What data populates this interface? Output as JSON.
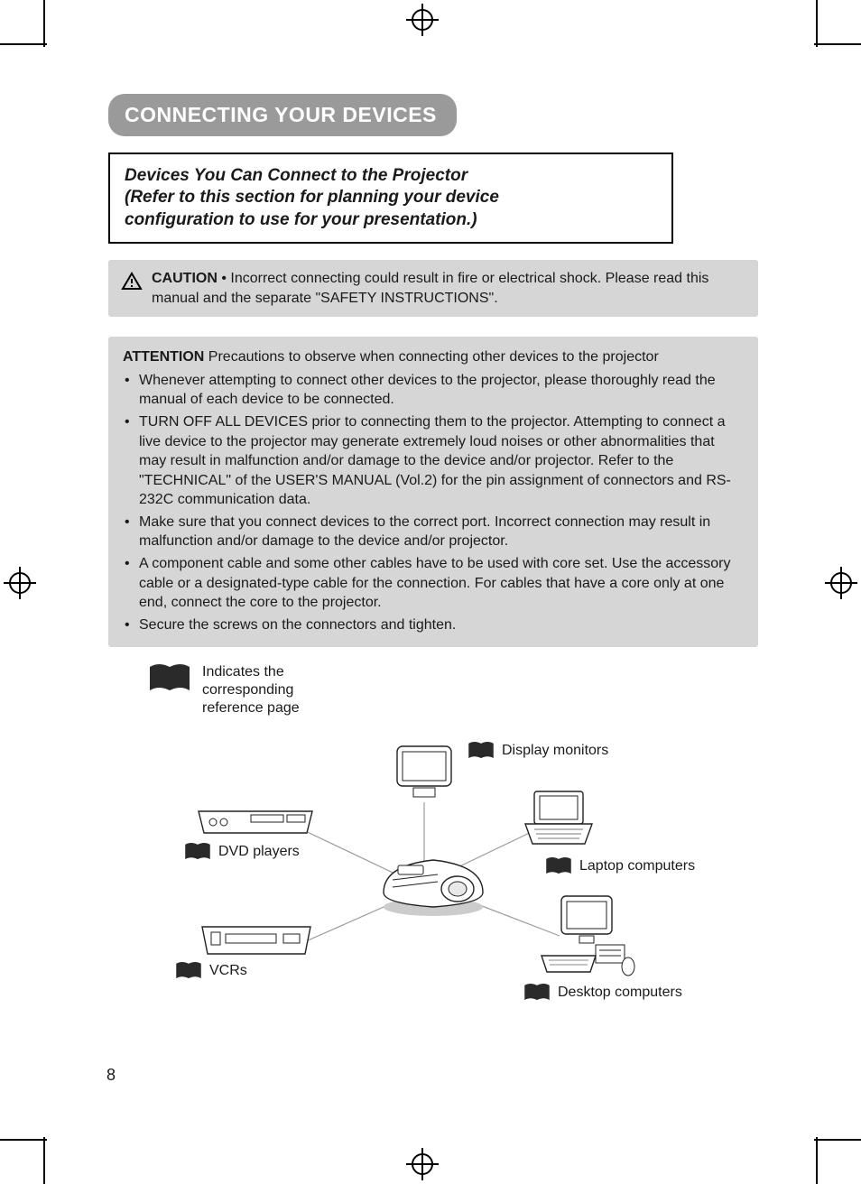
{
  "page_number": "8",
  "heading": "CONNECTING YOUR DEVICES",
  "subtitle_line1": "Devices You Can Connect to the Projector",
  "subtitle_line2": "(Refer to this section for planning your device",
  "subtitle_line3": "configuration to use for your presentation.)",
  "caution": {
    "label": "CAUTION",
    "text": " • Incorrect connecting could result in fire or electrical shock. Please read this manual and the separate \"SAFETY INSTRUCTIONS\"."
  },
  "attention": {
    "label": "ATTENTION",
    "intro": "  Precautions to observe when connecting other devices to the projector",
    "bullets": [
      "Whenever attempting to connect other devices to the projector, please thoroughly read the manual of each device to be connected.",
      "TURN OFF ALL DEVICES prior to connecting them to the projector. Attempting to connect a live device to the projector may generate extremely loud noises or other abnormalities that may result in malfunction and/or damage to the device and/or projector. Refer to the \"TECHNICAL\" of the USER'S MANUAL (Vol.2) for the pin assignment of connectors and RS-232C communication data.",
      "Make sure that you connect devices to the correct port. Incorrect connection may result in malfunction and/or damage to the device and/or projector.",
      "A component cable and some other cables have to be used with core set. Use the accessory cable or a designated-type cable for the connection. For cables that have a core only at one end, connect the core to the projector.",
      "Secure the screws on the connectors and tighten."
    ]
  },
  "legend_text": "Indicates the corresponding reference page",
  "devices": {
    "display_monitors": "Display monitors",
    "dvd_players": "DVD players",
    "laptop_computers": "Laptop computers",
    "vcrs": "VCRs",
    "desktop_computers": "Desktop computers"
  }
}
